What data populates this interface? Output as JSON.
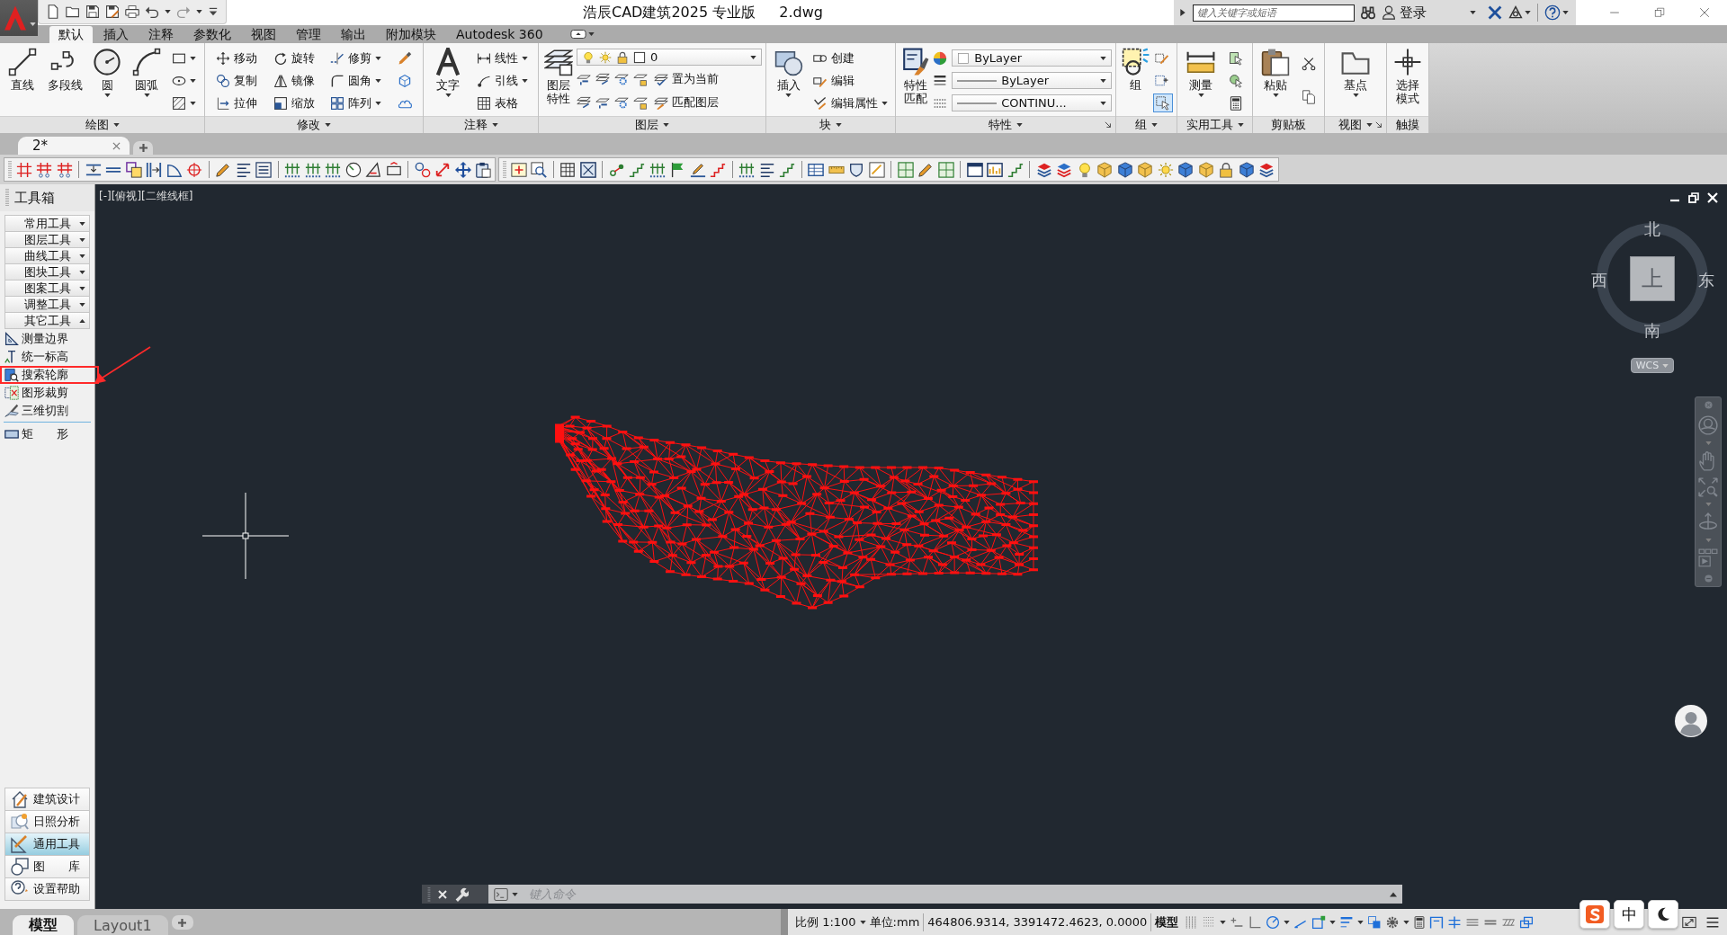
{
  "title_bar": {
    "app_title": "浩辰CAD建筑2025 专业版",
    "file_name": "2.dwg",
    "search": {
      "placeholder": "键入关键字或短语"
    },
    "login": "登录"
  },
  "ribbon": {
    "tabs": [
      {
        "label": "默认",
        "selected": true
      },
      {
        "label": "插入",
        "selected": false
      },
      {
        "label": "注释",
        "selected": false
      },
      {
        "label": "参数化",
        "selected": false
      },
      {
        "label": "视图",
        "selected": false
      },
      {
        "label": "管理",
        "selected": false
      },
      {
        "label": "输出",
        "selected": false
      },
      {
        "label": "附加模块",
        "selected": false
      },
      {
        "label": "Autodesk 360",
        "selected": false
      }
    ],
    "panels": [
      {
        "title": "绘图",
        "menu": true,
        "blocks": [
          {
            "kind": "large",
            "label": "直线",
            "dropdown": false
          },
          {
            "kind": "large",
            "label": "多段线",
            "dropdown": false
          },
          {
            "kind": "large",
            "label": "圆",
            "dropdown": true
          },
          {
            "kind": "large",
            "label": "圆弧",
            "dropdown": true
          },
          {
            "kind": "stack",
            "items": [
              {
                "kind": "button",
                "dropdown": true
              },
              {
                "kind": "button",
                "dropdown": true
              },
              {
                "kind": "button",
                "dropdown": true
              }
            ]
          }
        ]
      },
      {
        "title": "修改",
        "menu": true,
        "blocks": [
          {
            "kind": "stack",
            "items": [
              {
                "kind": "button",
                "label": "移动",
                "dropdown": false
              },
              {
                "kind": "button",
                "label": "复制",
                "dropdown": false
              },
              {
                "kind": "button",
                "label": "拉伸",
                "dropdown": false
              }
            ]
          },
          {
            "kind": "stack",
            "items": [
              {
                "kind": "button",
                "label": "旋转",
                "dropdown": false
              },
              {
                "kind": "button",
                "label": "镜像",
                "dropdown": false
              },
              {
                "kind": "button",
                "label": "缩放",
                "dropdown": false
              }
            ]
          },
          {
            "kind": "stack",
            "items": [
              {
                "kind": "button",
                "label": "修剪",
                "dropdown": true
              },
              {
                "kind": "button",
                "label": "圆角",
                "dropdown": true
              },
              {
                "kind": "button",
                "label": "阵列",
                "dropdown": true
              }
            ]
          },
          {
            "kind": "stack",
            "items": [
              {
                "kind": "button",
                "dropdown": false
              },
              {
                "kind": "button",
                "dropdown": false
              },
              {
                "kind": "button",
                "dropdown": false
              }
            ]
          }
        ]
      },
      {
        "title": "注释",
        "menu": true,
        "blocks": [
          {
            "kind": "large",
            "label": "文字",
            "dropdown": true
          },
          {
            "kind": "stack",
            "items": [
              {
                "kind": "button",
                "label": "线性",
                "dropdown": true
              },
              {
                "kind": "button",
                "label": "引线",
                "dropdown": true
              },
              {
                "kind": "button",
                "label": "表格",
                "dropdown": false
              }
            ]
          }
        ]
      },
      {
        "title": "图层",
        "menu": true,
        "blocks": [
          {
            "kind": "large",
            "label": "图层特性",
            "dropdown": false
          },
          {
            "kind": "stack",
            "items": [
              {
                "kind": "combo",
                "value": "0"
              },
              {
                "kind": "toolrow",
                "label": "置为当前"
              },
              {
                "kind": "toolrow",
                "label": "匹配图层"
              }
            ]
          }
        ]
      },
      {
        "title": "块",
        "menu": true,
        "blocks": [
          {
            "kind": "large",
            "label": "插入",
            "dropdown": true
          },
          {
            "kind": "stack",
            "items": [
              {
                "kind": "button",
                "label": "创建",
                "dropdown": false
              },
              {
                "kind": "button",
                "label": "编辑",
                "dropdown": false
              },
              {
                "kind": "button",
                "label": "编辑属性",
                "dropdown": true
              }
            ]
          }
        ]
      },
      {
        "title": "特性",
        "menu": true,
        "launcher": true,
        "blocks": [
          {
            "kind": "large",
            "label": "特性匹配",
            "dropdown": false
          },
          {
            "kind": "stack",
            "items": [
              {
                "kind": "combo",
                "value": "ByLayer"
              },
              {
                "kind": "combo",
                "value": "ByLayer"
              },
              {
                "kind": "combo",
                "value": "CONTINU..."
              }
            ]
          }
        ]
      },
      {
        "title": "组",
        "menu": true,
        "blocks": [
          {
            "kind": "large",
            "label": "组",
            "dropdown": false
          },
          {
            "kind": "stack",
            "items": [
              {
                "kind": "button",
                "on": false
              },
              {
                "kind": "button",
                "on": false
              },
              {
                "kind": "button",
                "on": true
              }
            ]
          }
        ]
      },
      {
        "title": "实用工具",
        "menu": true,
        "blocks": [
          {
            "kind": "large",
            "label": "测量",
            "dropdown": true
          },
          {
            "kind": "stack",
            "items": [
              {
                "kind": "button"
              },
              {
                "kind": "button"
              },
              {
                "kind": "button"
              }
            ]
          }
        ]
      },
      {
        "title": "剪贴板",
        "menu": false,
        "blocks": [
          {
            "kind": "large",
            "label": "粘贴",
            "dropdown": true
          },
          {
            "kind": "stack",
            "items": [
              {
                "kind": "button"
              },
              {
                "kind": "button"
              }
            ]
          }
        ]
      },
      {
        "title": "视图",
        "menu": true,
        "launcher": true,
        "blocks": [
          {
            "kind": "large",
            "label": "基点",
            "dropdown": true
          }
        ]
      },
      {
        "title": "触摸",
        "menu": false,
        "blocks": [
          {
            "kind": "large",
            "label": "选择模式",
            "dropdown": false
          }
        ]
      }
    ]
  },
  "document_tabs": [
    {
      "label": "2*",
      "selected": true
    }
  ],
  "toolbox": {
    "title": "工具箱",
    "groups": [
      {
        "label": "常用工具",
        "expanded": false
      },
      {
        "label": "图层工具",
        "expanded": false
      },
      {
        "label": "曲线工具",
        "expanded": false
      },
      {
        "label": "图块工具",
        "expanded": false
      },
      {
        "label": "图案工具",
        "expanded": false
      },
      {
        "label": "调整工具",
        "expanded": false
      },
      {
        "label": "其它工具",
        "expanded": true
      }
    ],
    "items": [
      {
        "label": "测量边界",
        "highlighted": false
      },
      {
        "label": "统一标高",
        "highlighted": false
      },
      {
        "label": "搜索轮廓",
        "highlighted": true
      },
      {
        "label": "图形裁剪",
        "highlighted": false
      },
      {
        "label": "三维切割",
        "highlighted": false
      },
      {
        "label": "矩　　形",
        "highlighted": false
      }
    ],
    "modules": [
      {
        "label": "建筑设计",
        "selected": false
      },
      {
        "label": "日照分析",
        "selected": false
      },
      {
        "label": "通用工具",
        "selected": true
      },
      {
        "label": "图　　库",
        "selected": false
      },
      {
        "label": "设置帮助",
        "selected": false
      }
    ]
  },
  "viewport": {
    "label": "[-][俯视][二维线框]",
    "compass": {
      "north": "北",
      "south": "南",
      "west": "西",
      "east": "东"
    },
    "top_face": "上",
    "ucs": "WCS"
  },
  "command_line": {
    "placeholder": "键入命令"
  },
  "layout_tabs": [
    {
      "label": "模型",
      "selected": true
    },
    {
      "label": "Layout1",
      "selected": false
    }
  ],
  "status_bar": {
    "scale": "比例 1:100",
    "unit": "单位:mm",
    "coordinates": "464806.9314, 3391472.4623, 0.0000",
    "space": "模型",
    "toggles": [
      {
        "on": false
      },
      {
        "on": false
      },
      {
        "on": false
      },
      {
        "on": false
      },
      {
        "on": true
      },
      {
        "on": true
      },
      {
        "on": true
      },
      {
        "on": true
      },
      {
        "on": true
      },
      {
        "on": true
      },
      {
        "on": true
      },
      {
        "on": false
      },
      {
        "on": false
      },
      {
        "on": false
      },
      {
        "on": true
      }
    ]
  },
  "ime": {
    "mode": "中"
  }
}
